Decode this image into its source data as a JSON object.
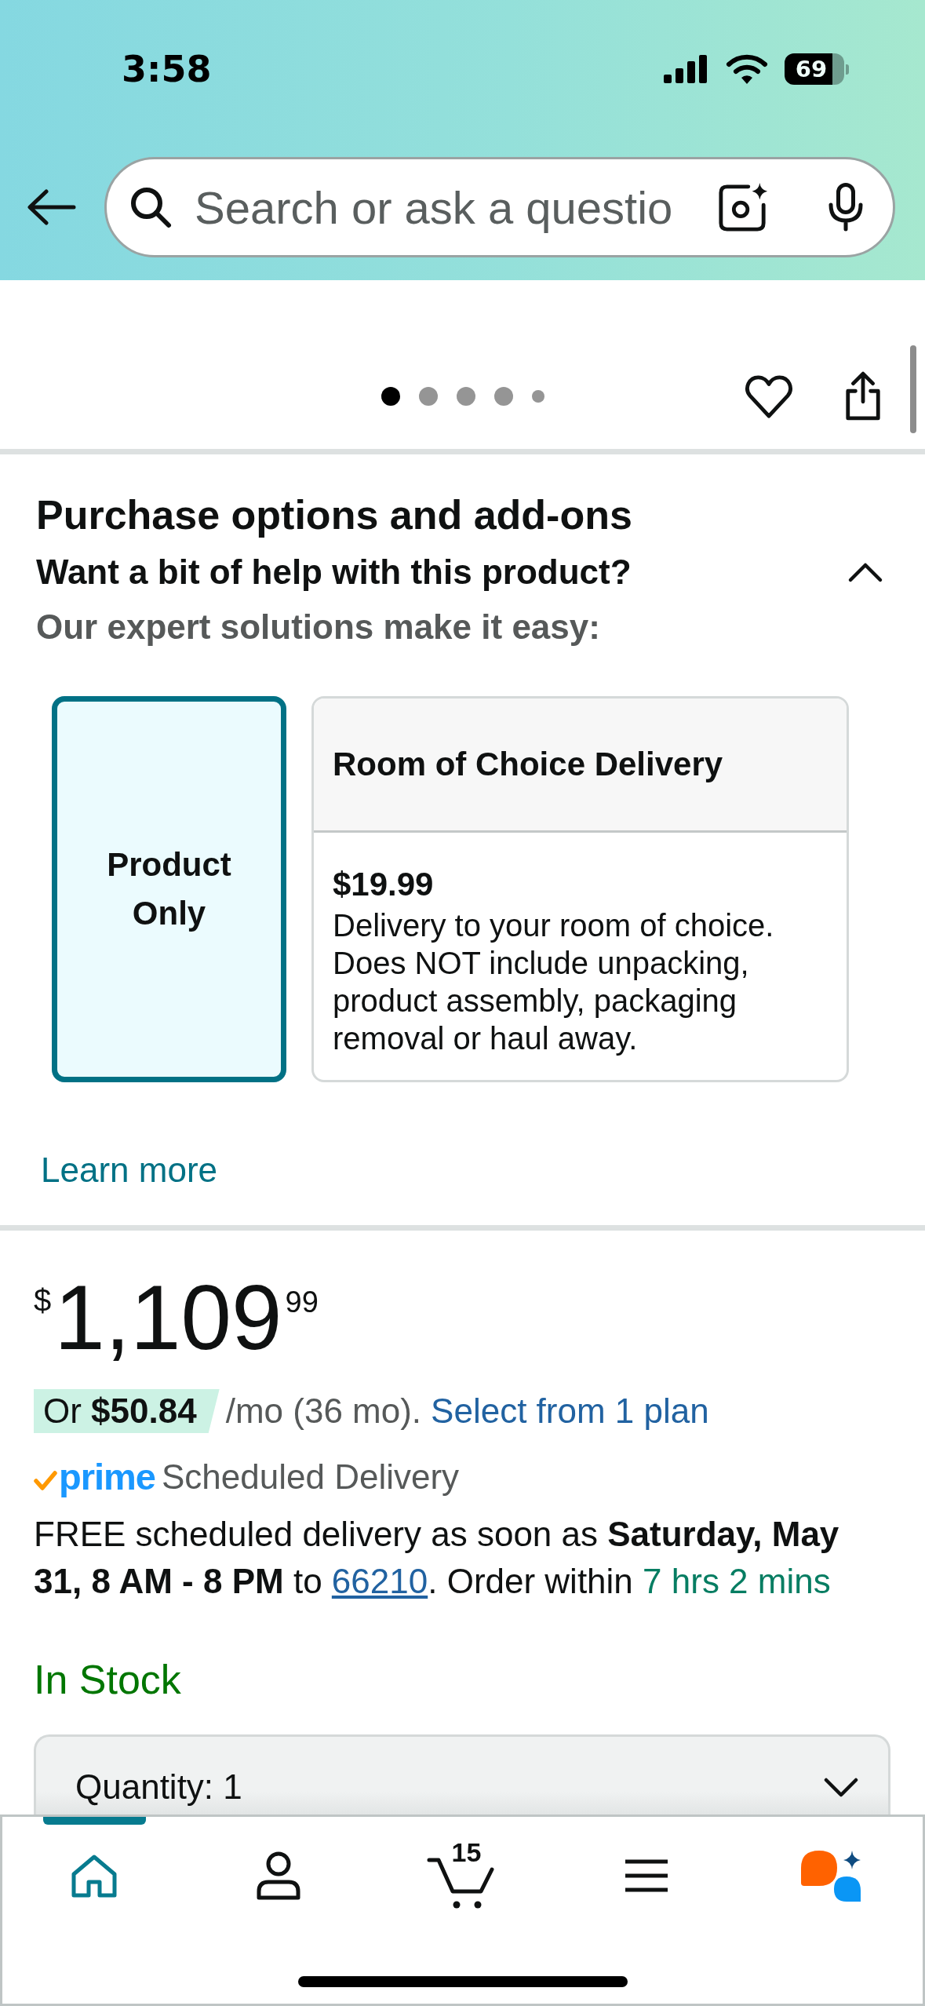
{
  "status_bar": {
    "time": "3:58",
    "battery": "69"
  },
  "search": {
    "placeholder": "Search or ask a questio"
  },
  "gallery": {
    "dots": [
      {
        "selected": true
      },
      {
        "selected": false
      },
      {
        "selected": false
      },
      {
        "selected": false
      },
      {
        "selected": false
      }
    ]
  },
  "purchase_options": {
    "title": "Purchase options and add-ons",
    "subtitle": "Want a bit of help with this product?",
    "expanded": true,
    "intro": "Our expert solutions make it easy:",
    "options": [
      {
        "kind": "plain",
        "title": "Product Only",
        "selected": true
      },
      {
        "kind": "service",
        "title": "Room of Choice Delivery",
        "price": "$19.99",
        "description": "Delivery to your room of choice. Does NOT include unpacking, product assembly, packaging removal or haul away.",
        "selected": false
      }
    ],
    "link": "Learn more"
  },
  "price": {
    "currency": "$",
    "whole": "1,109",
    "fraction": "99"
  },
  "financing": {
    "offer": "Or **$50.84**",
    "terms": "/mo (36 mo).",
    "link": "Select from 1 plan"
  },
  "delivery": {
    "badge": "prime",
    "label": "Scheduled Delivery",
    "message": [
      {
        "kind": "text",
        "text": "FREE scheduled delivery as soon as **Saturday, May 31, 8 AM - 8 PM** to "
      },
      {
        "kind": "link",
        "text": "66210"
      },
      {
        "kind": "text",
        "text": ". Order within "
      },
      {
        "kind": "countdown",
        "text": "7 hrs 2 mins"
      }
    ]
  },
  "availability": "In Stock",
  "quantity": {
    "label": "Quantity:",
    "value": "1"
  },
  "bottom_nav": [
    {
      "kind": "home",
      "selected": true
    },
    {
      "kind": "account",
      "selected": false
    },
    {
      "kind": "cart",
      "selected": false,
      "count": "15"
    },
    {
      "kind": "menu",
      "selected": false
    },
    {
      "kind": "assistant",
      "selected": false
    }
  ]
}
